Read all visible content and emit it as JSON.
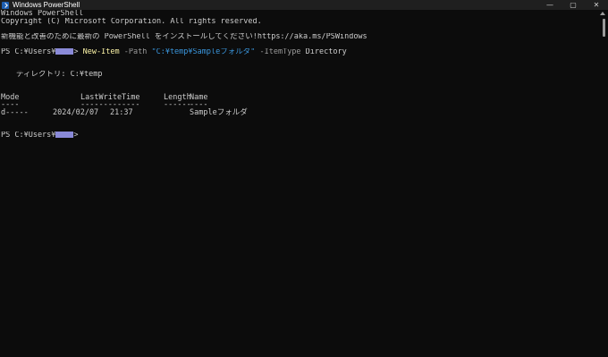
{
  "window": {
    "title": "Windows PowerShell",
    "controls": {
      "minimize": "—",
      "maximize": "▢",
      "close": "✕"
    }
  },
  "console": {
    "banner_line1": "Windows PowerShell",
    "banner_line2": "Copyright (C) Microsoft Corporation. All rights reserved.",
    "notice": "新機能と改善のために最新の PowerShell をインストールしてください!https://aka.ms/PSWindows",
    "prompt_prefix": "PS C:¥Users¥",
    "prompt_suffix": ">",
    "command": {
      "cmdlet": "New-Item",
      "path_param": "-Path",
      "path_value": "\"C:¥temp¥Sampleフォルダ\"",
      "type_param": "-ItemType",
      "type_value": "Directory"
    },
    "directory_label": "ディレクトリ: C:¥temp",
    "table": {
      "headers": {
        "mode": "Mode",
        "lastwritetime": "LastWriteTime",
        "length": "Length",
        "name": "Name"
      },
      "underlines": {
        "mode": "----",
        "lastwritetime": "-------------",
        "length": "------",
        "name": "----"
      },
      "rows": [
        {
          "mode": "d-----",
          "date": "2024/02/07",
          "time": "21:37",
          "length": "",
          "name": "Sampleフォルダ"
        }
      ]
    }
  }
}
